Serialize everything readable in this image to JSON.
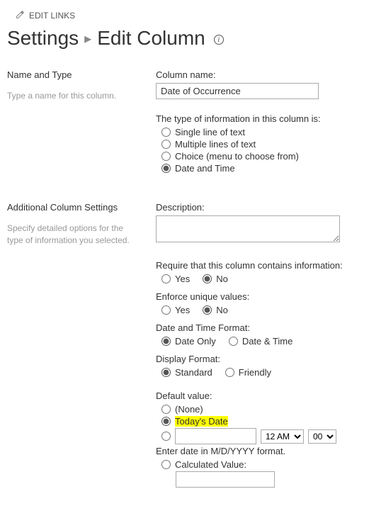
{
  "editLinks": "EDIT LINKS",
  "breadcrumb": {
    "root": "Settings",
    "current": "Edit Column"
  },
  "section1": {
    "heading": "Name and Type",
    "hint": "Type a name for this column.",
    "colNameLabel": "Column name:",
    "colNameValue": "Date of Occurrence",
    "typeLabel": "The type of information in this column is:",
    "types": {
      "single": "Single line of text",
      "multi": "Multiple lines of text",
      "choice": "Choice (menu to choose from)",
      "datetime": "Date and Time"
    }
  },
  "section2": {
    "heading": "Additional Column Settings",
    "hint": "Specify detailed options for the type of information you selected.",
    "descriptionLabel": "Description:",
    "descriptionValue": "",
    "requireLabel": "Require that this column contains information:",
    "yes": "Yes",
    "no": "No",
    "uniqueLabel": "Enforce unique values:",
    "dtFormatLabel": "Date and Time Format:",
    "dateOnly": "Date Only",
    "dateTime": "Date & Time",
    "dispFormatLabel": "Display Format:",
    "standard": "Standard",
    "friendly": "Friendly",
    "defaultLabel": "Default value:",
    "none": "(None)",
    "today": "Today's Date",
    "customDate": "",
    "ampm": "12 AM",
    "minutes": "00",
    "enterDateHint": "Enter date in M/D/YYYY format.",
    "calculated": "Calculated Value:",
    "calculatedValue": ""
  }
}
